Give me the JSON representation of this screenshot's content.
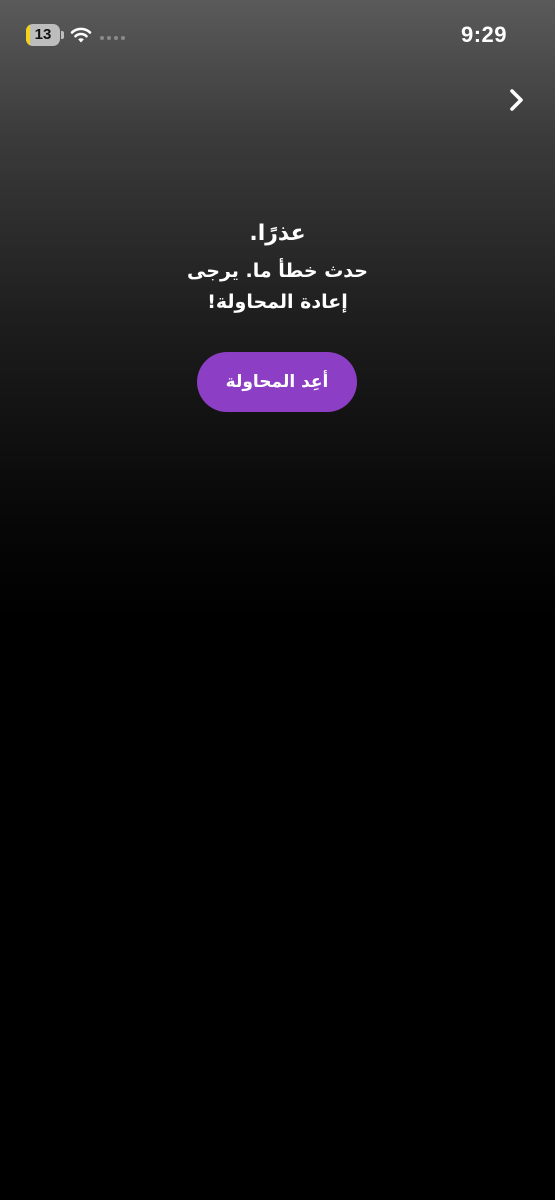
{
  "status_bar": {
    "battery_level": "13",
    "battery_percent": 13,
    "battery_fill_color": "#f2d21b",
    "wifi_icon": "wifi-icon",
    "signal_icon": "cellular-signal-icon",
    "time": "9:29"
  },
  "navigation": {
    "next_icon": "chevron-right-icon"
  },
  "error": {
    "title": "عذرًا.",
    "message": "حدث خطأ ما. يرجى إعادة المحاولة!"
  },
  "actions": {
    "retry_label": "أعِد المحاولة",
    "retry_color": "#8c3fc4"
  }
}
